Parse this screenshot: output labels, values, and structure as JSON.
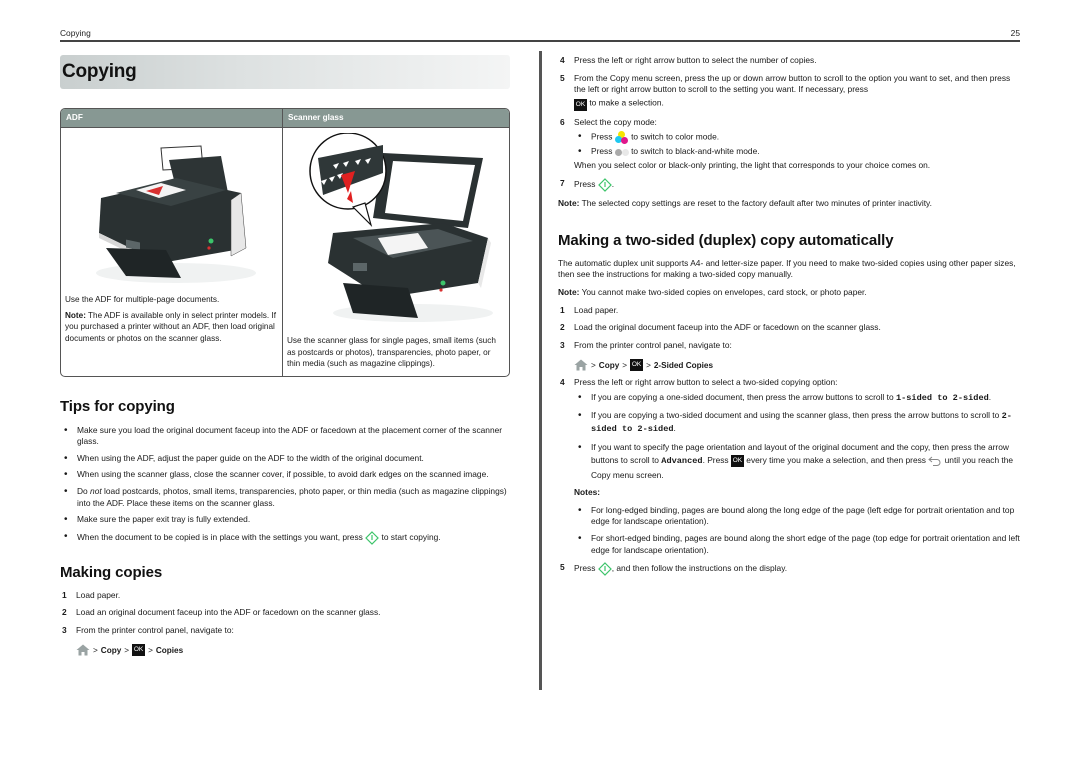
{
  "running_head": {
    "section": "Copying",
    "page_number": "25"
  },
  "page_title": "Copying",
  "comparison_table": {
    "headers": [
      "ADF",
      "Scanner glass"
    ],
    "adf": {
      "image": "printer-with-adf-illustration",
      "text": "Use the ADF for multiple-page documents.",
      "note_label": "Note:",
      "note_text": " The ADF is available only in select printer models. If you purchased a printer without an ADF, then load original documents or photos on the scanner glass."
    },
    "scanner_glass": {
      "image": "printer-scanner-glass-illustration",
      "text": "Use the scanner glass for single pages, small items (such as postcards or photos), transparencies, photo paper, or thin media (such as magazine clippings)."
    }
  },
  "tips": {
    "heading": "Tips for copying",
    "items": [
      {
        "text": "Make sure you load the original document faceup into the ADF or facedown at the placement corner of the scanner glass."
      },
      {
        "text": "When using the ADF, adjust the paper guide on the ADF to the width of the original document."
      },
      {
        "text": "When using the scanner glass, close the scanner cover, if possible, to avoid dark edges on the scanned image."
      },
      {
        "pre": "Do ",
        "em": "not",
        "post": " load postcards, photos, small items, transparencies, photo paper, or thin media (such as magazine clippings) into the ADF. Place these items on the scanner glass."
      },
      {
        "text": "Make sure the paper exit tray is fully extended."
      },
      {
        "pre": "When the document to be copied is in place with the settings you want, press ",
        "icon": "start-icon",
        "post": " to start copying."
      }
    ]
  },
  "making_copies": {
    "heading": "Making copies",
    "steps": [
      {
        "num": "1",
        "text": "Load paper."
      },
      {
        "num": "2",
        "text": "Load an original document faceup into the ADF or facedown on the scanner glass."
      },
      {
        "num": "3",
        "text": "From the printer control panel, navigate to:"
      }
    ],
    "nav_path": {
      "sep": ">",
      "copy": "Copy",
      "ok": "OK",
      "target": "Copies"
    },
    "steps_continued": [
      {
        "num": "4",
        "text": "Press the left or right arrow button to select the number of copies."
      },
      {
        "num": "5",
        "text": "From the Copy menu screen, press the up or down arrow button to scroll to the option you want to set, and then press the left or right arrow button to scroll to the setting you want. If necessary, press",
        "post": " to make a selection."
      },
      {
        "num": "6",
        "text": "Select the copy mode:"
      }
    ],
    "mode_bullets": [
      {
        "pre": "Press ",
        "post": " to switch to color mode."
      },
      {
        "pre": "Press ",
        "post": " to switch to black-and-white mode."
      }
    ],
    "mode_after": "When you select color or black-only printing, the light that corresponds to your choice comes on.",
    "step7": {
      "num": "7",
      "pre": "Press ",
      "post": "."
    },
    "note_label": "Note:",
    "note_text": " The selected copy settings are reset to the factory default after two minutes of printer inactivity."
  },
  "duplex": {
    "heading": "Making a two-sided (duplex) copy automatically",
    "intro": "The automatic duplex unit supports A4- and letter-size paper. If you need to make two-sided copies using other paper sizes, then see the instructions for making a two-sided copy manually.",
    "note_label": "Note:",
    "note_text": " You cannot make two-sided copies on envelopes, card stock, or photo paper.",
    "steps": [
      {
        "num": "1",
        "text": "Load paper."
      },
      {
        "num": "2",
        "text": "Load the original document faceup into the ADF or facedown on the scanner glass."
      },
      {
        "num": "3",
        "text": "From the printer control panel, navigate to:"
      }
    ],
    "nav_path": {
      "sep": ">",
      "copy": "Copy",
      "ok": "OK",
      "target": "2-Sided Copies"
    },
    "step4": {
      "num": "4",
      "text": "Press the left or right arrow button to select a two-sided copying option:"
    },
    "options": [
      {
        "pre": "If you are copying a one-sided document, then press the arrow buttons to scroll to ",
        "code": "1-sided to 2-sided",
        "post": "."
      },
      {
        "pre": "If you are copying a two-sided document and using the scanner glass, then press the arrow buttons to scroll to ",
        "code": "2-sided to 2-sided",
        "post": "."
      },
      {
        "pre": "If you want to specify the page orientation and layout of the original document and the copy, then press the arrow buttons to scroll to ",
        "code": "Advanced",
        "mid": ". Press ",
        "mid2": " every time you make a selection, and then press ",
        "post": " until you reach the Copy menu screen."
      }
    ],
    "notes_heading": "Notes:",
    "notes": [
      "For long-edged binding, pages are bound along the long edge of the page (left edge for portrait orientation and top edge for landscape orientation).",
      "For short-edged binding, pages are bound along the short edge of the page (top edge for portrait orientation and left edge for landscape orientation)."
    ],
    "step5": {
      "num": "5",
      "pre": "Press ",
      "post": ", and then follow the instructions on the display."
    }
  },
  "colors": {
    "table_header": "#879893",
    "start_button": "#3cc46a",
    "ink_yellow": "#f5e400",
    "ink_cyan": "#1ec8f0",
    "ink_magenta": "#e0178c",
    "mono_light": "#aaaaaa"
  }
}
